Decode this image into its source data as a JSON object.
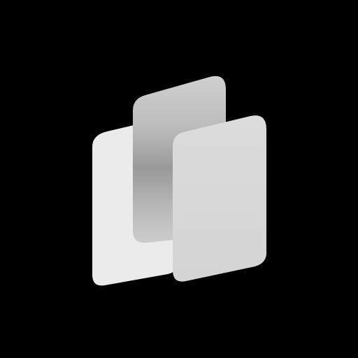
{
  "scene": {
    "background": "#000000",
    "icon": "stacked-panels-icon",
    "panels": [
      {
        "role": "back-left",
        "color": "#ebebeb"
      },
      {
        "role": "middle",
        "gradient": [
          "#c9c9c9",
          "#9a9a9a",
          "#d0d0d0"
        ]
      },
      {
        "role": "front-right",
        "color": "#d9d9d9"
      }
    ]
  }
}
